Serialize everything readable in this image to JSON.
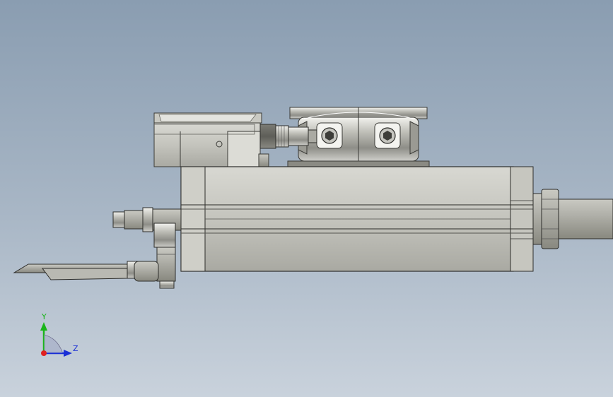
{
  "viewport": {
    "background_top": "#8a9db1",
    "background_bottom": "#c9d2dc"
  },
  "triad": {
    "y_label": "Y",
    "z_label": "Z",
    "y_color": "#1ab51a",
    "z_color": "#1a2fd6",
    "x_color": "#e02020"
  }
}
